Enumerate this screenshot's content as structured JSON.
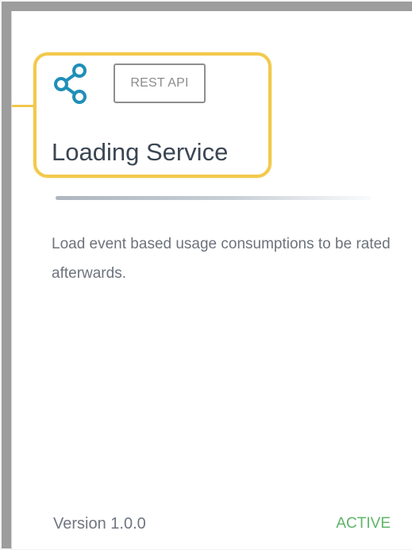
{
  "card": {
    "badge": "REST API",
    "title": "Loading Service",
    "description": "Load event based usage consumptions to be rated afterwards.",
    "version": "Version 1.0.0",
    "status": "ACTIVE"
  },
  "icons": {
    "share": "share-icon"
  },
  "colors": {
    "highlight": "#f2c94c",
    "accent": "#1f8fb7",
    "status": "#60b46a"
  }
}
